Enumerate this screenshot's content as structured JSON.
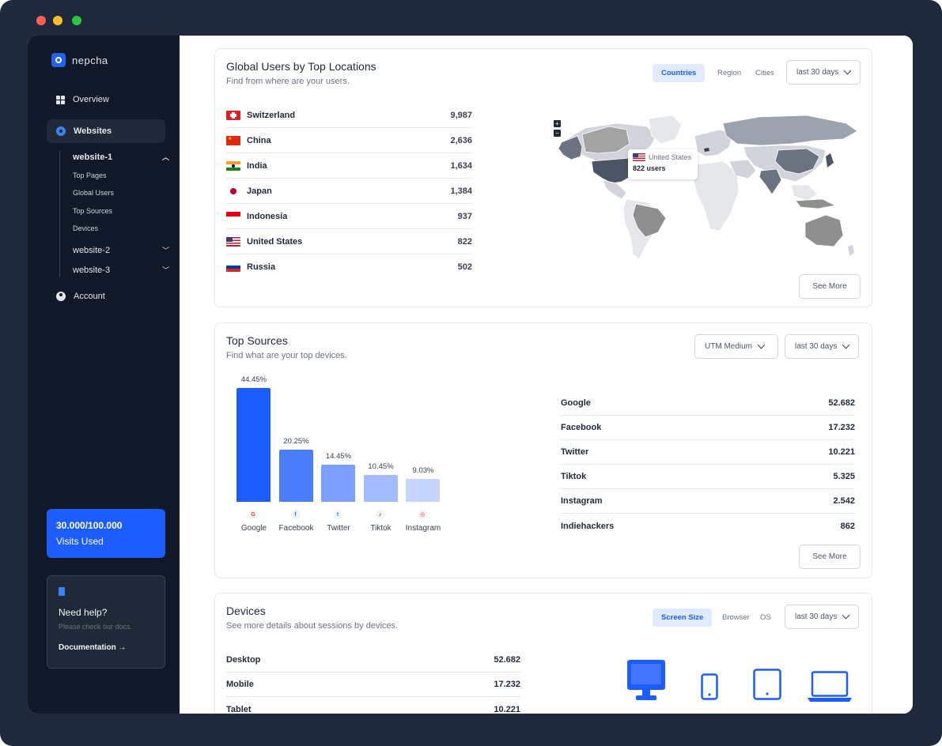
{
  "app": {
    "brand": "nepcha"
  },
  "sidebar": {
    "nav": [
      {
        "label": "Overview"
      },
      {
        "label": "Websites"
      },
      {
        "label": "Account"
      }
    ],
    "websites": [
      {
        "label": "website-1",
        "children": [
          "Top Pages",
          "Global Users",
          "Top Sources",
          "Devices"
        ]
      },
      {
        "label": "website-2"
      },
      {
        "label": "website-3"
      }
    ],
    "visits": {
      "count": "30.000/100.000",
      "label": "Visits Used"
    },
    "help": {
      "title": "Need help?",
      "text": "Please check our docs.",
      "link": "Documentation →"
    }
  },
  "locations": {
    "title": "Global Users by Top Locations",
    "subtitle": "Find from where are your users.",
    "tabs": [
      "Countries",
      "Region",
      "Cities"
    ],
    "range": "last 30 days",
    "rows": [
      {
        "country": "Switzerland",
        "value": "9,987"
      },
      {
        "country": "China",
        "value": "2,636"
      },
      {
        "country": "India",
        "value": "1,634"
      },
      {
        "country": "Japan",
        "value": "1,384"
      },
      {
        "country": "Indonesia",
        "value": "937"
      },
      {
        "country": "United States",
        "value": "822"
      },
      {
        "country": "Russia",
        "value": "502"
      }
    ],
    "tooltip": {
      "country": "United States",
      "users": "822 users"
    },
    "see_more": "See More"
  },
  "sources": {
    "title": "Top Sources",
    "subtitle": "Find what are your top devices.",
    "medium": "UTM Medium",
    "range": "last 30 days",
    "rows": [
      {
        "name": "Google",
        "value": "52.682"
      },
      {
        "name": "Facebook",
        "value": "17.232"
      },
      {
        "name": "Twitter",
        "value": "10.221"
      },
      {
        "name": "Tiktok",
        "value": "5.325"
      },
      {
        "name": "Instagram",
        "value": "2.542"
      },
      {
        "name": "Indiehackers",
        "value": "862"
      }
    ],
    "see_more": "See More"
  },
  "chart_data": {
    "type": "bar",
    "categories": [
      "Google",
      "Facebook",
      "Twitter",
      "Tiktok",
      "Instagram"
    ],
    "values": [
      44.45,
      20.25,
      14.45,
      10.45,
      9.03
    ],
    "labels": [
      "44.45%",
      "20.25%",
      "14.45%",
      "10.45%",
      "9.03%"
    ],
    "colors": [
      "#1d5cff",
      "#4a7dff",
      "#7b9fff",
      "#a3bcff",
      "#c5d5ff"
    ],
    "icons": [
      "google-icon",
      "facebook-icon",
      "twitter-icon",
      "tiktok-icon",
      "instagram-icon"
    ],
    "icon_glyphs": [
      "G",
      "f",
      "t",
      "♪",
      "◎"
    ],
    "icon_colors": [
      "#ea4335",
      "#1877f2",
      "#1d9bf0",
      "#111827",
      "#e1306c"
    ],
    "ylim": [
      0,
      44.45
    ],
    "title": "",
    "xlabel": "",
    "ylabel": ""
  },
  "devices": {
    "title": "Devices",
    "subtitle": "See more details about sessions by devices.",
    "tabs": [
      "Screen Size",
      "Browser",
      "OS"
    ],
    "range": "last 30 days",
    "rows": [
      {
        "name": "Desktop",
        "value": "52.682"
      },
      {
        "name": "Mobile",
        "value": "17.232"
      },
      {
        "name": "Tablet",
        "value": "10.221"
      }
    ]
  },
  "colors": {
    "accent": "#1d5cff",
    "sidebar": "#111827",
    "frame": "#1e293b"
  }
}
